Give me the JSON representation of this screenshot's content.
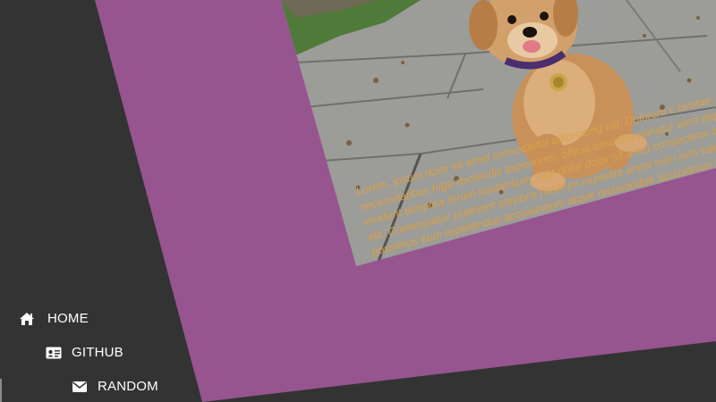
{
  "nav": {
    "items": [
      {
        "label": "HOME",
        "icon": "home-icon"
      },
      {
        "label": "GITHUB",
        "icon": "id-card-icon"
      },
      {
        "label": "RANDOM",
        "icon": "envelope-icon"
      }
    ]
  },
  "content": {
    "photo_alt": "golden retriever puppy",
    "paragraph": "Lorem, ipsum dolor sit amet consectetur adipisicing elit. Dolorum c beatae, necessitatibus fuga reiciendis asperiores, officia assumer pariatur vero atque incidunt tempora rerum laudantium, odit dolor dolor sit amet consectetur adipisicing elit. Consequatur praesent corporis nostrum expedita animi nam rem saepe possimus eum repellendus accusantium atque recusandae accusamus velit? (",
    "text_color": "#d9a14a"
  },
  "colors": {
    "background": "#333333",
    "panel": "#96558f",
    "nav_text": "#ffffff"
  }
}
